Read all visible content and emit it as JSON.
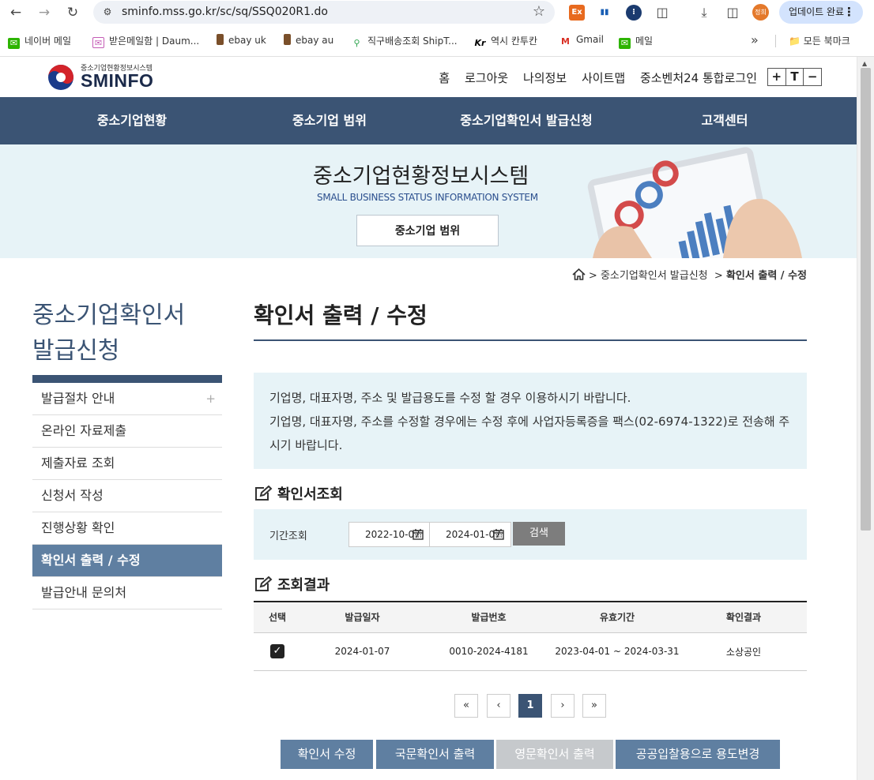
{
  "browser": {
    "url": "sminfo.mss.go.kr/sc/sq/SSQ020R1.do",
    "update_label": "업데이트 완료",
    "profile_initials": "정희",
    "bookmarks": [
      {
        "label": "네이버 메일",
        "icon": "naver-mail-icon"
      },
      {
        "label": "받은메일함 | Daum...",
        "icon": "daum-mail-icon"
      },
      {
        "label": "ebay uk",
        "icon": "ebay-icon"
      },
      {
        "label": "ebay au",
        "icon": "ebay-icon"
      },
      {
        "label": "직구배송조회 ShipT...",
        "icon": "shiptrack-icon"
      },
      {
        "label": "역시 칸투칸",
        "icon": "kantukan-icon"
      },
      {
        "label": "Gmail",
        "icon": "gmail-icon"
      },
      {
        "label": "메일",
        "icon": "mail-icon"
      }
    ],
    "all_bookmarks_label": "모든 북마크",
    "more_label": "»"
  },
  "header": {
    "logo_sub": "중소기업현황정보시스템",
    "logo_main": "SMINFO",
    "util_links": [
      "홈",
      "로그아웃",
      "나의정보",
      "사이트맵",
      "중소벤처24 통합로그인"
    ],
    "font_controls": [
      "+",
      "T",
      "−"
    ]
  },
  "gnb": {
    "items": [
      "중소기업현황",
      "중소기업 범위",
      "중소기업확인서 발급신청",
      "고객센터"
    ]
  },
  "hero": {
    "title": "중소기업현황정보시스템",
    "subtitle": "SMALL BUSINESS STATUS INFORMATION SYSTEM",
    "button_label": "중소기업 범위"
  },
  "breadcrumb": {
    "level1": "중소기업확인서 발급신청",
    "current": "확인서 출력 / 수정"
  },
  "lnb": {
    "title_line1": "중소기업확인서",
    "title_line2": "발급신청",
    "items": [
      {
        "label": "발급절차 안내",
        "expandable": "+"
      },
      {
        "label": "온라인 자료제출"
      },
      {
        "label": "제출자료 조회"
      },
      {
        "label": "신청서 작성"
      },
      {
        "label": "진행상황 확인"
      },
      {
        "label": "확인서 출력 / 수정",
        "active": true
      },
      {
        "label": "발급안내 문의처"
      }
    ]
  },
  "content": {
    "title": "확인서 출력 / 수정",
    "notice_line1": "기업명, 대표자명, 주소 및 발급용도를 수정 할 경우 이용하시기 바랍니다.",
    "notice_line2": "기업명, 대표자명, 주소를 수정할 경우에는 수정 후에 사업자등록증을 팩스(02-6974-1322)로 전송해 주시기 바랍니다.",
    "search_section_title": "확인서조회",
    "search": {
      "label": "기간조회",
      "date_from": "2022-10-07",
      "date_to": "2024-01-07",
      "button_label": "검색"
    },
    "result_section_title": "조회결과",
    "table": {
      "headers": [
        "선택",
        "발급일자",
        "발급번호",
        "유효기간",
        "확인결과"
      ],
      "rows": [
        {
          "selected": true,
          "issue_date": "2024-01-07",
          "issue_no": "0010-2024-4181",
          "valid_period": "2023-04-01 ~ 2024-03-31",
          "result": "소상공인"
        }
      ]
    },
    "pager": {
      "first": "«",
      "prev": "‹",
      "current": "1",
      "next": "›",
      "last": "»"
    },
    "buttons": [
      {
        "label": "확인서 수정",
        "enabled": true
      },
      {
        "label": "국문확인서 출력",
        "enabled": true
      },
      {
        "label": "영문확인서 출력",
        "enabled": false
      },
      {
        "label": "공공입찰용으로 용도변경",
        "enabled": true
      }
    ]
  },
  "colors": {
    "navy": "#3b5474",
    "lnb_active": "#5f7fa1",
    "light_blue_bg": "#e7f3f7",
    "disabled": "#c6c9cc"
  }
}
